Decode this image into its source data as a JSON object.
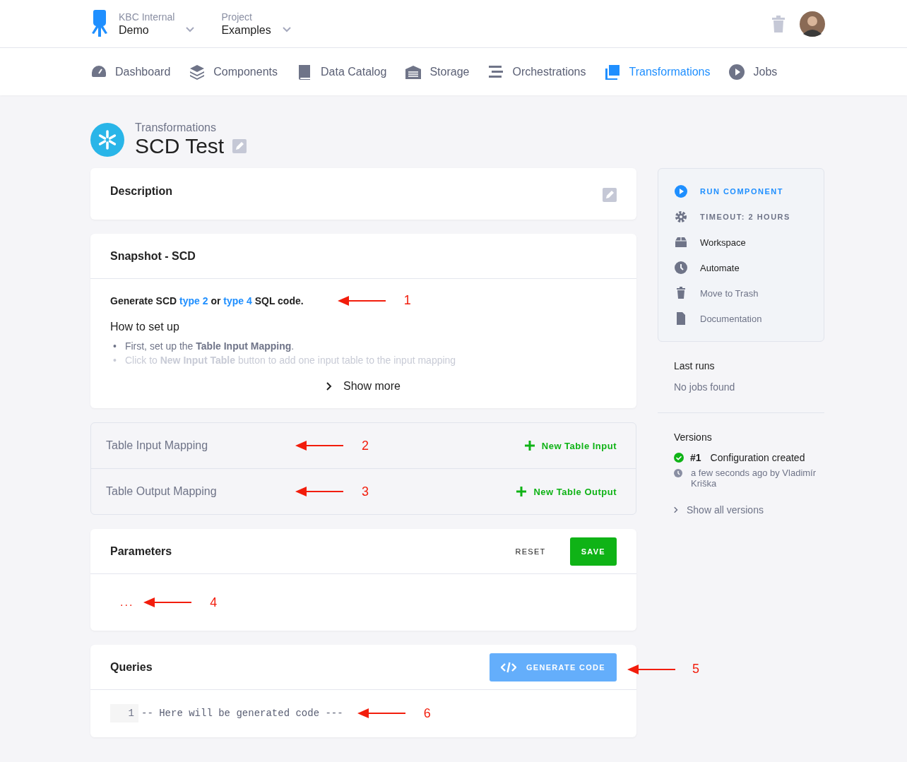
{
  "header": {
    "org_label": "KBC Internal",
    "org_name": "Demo",
    "project_label": "Project",
    "project_name": "Examples"
  },
  "nav": [
    {
      "label": "Dashboard",
      "selected": false
    },
    {
      "label": "Components",
      "selected": false
    },
    {
      "label": "Data Catalog",
      "selected": false
    },
    {
      "label": "Storage",
      "selected": false
    },
    {
      "label": "Orchestrations",
      "selected": false
    },
    {
      "label": "Transformations",
      "selected": true
    },
    {
      "label": "Jobs",
      "selected": false
    }
  ],
  "page": {
    "breadcrumb": "Transformations",
    "title": "SCD Test"
  },
  "description": {
    "title": "Description"
  },
  "snapshot": {
    "title": "Snapshot - SCD",
    "intro_parts": [
      {
        "text": "Generate SCD ",
        "kind": "text"
      },
      {
        "text": "type 2",
        "kind": "link"
      },
      {
        "text": " or ",
        "kind": "text"
      },
      {
        "text": "type 4",
        "kind": "link"
      },
      {
        "text": " SQL code.",
        "kind": "text"
      }
    ],
    "heading": "How to set up",
    "bullets": [
      {
        "marker": "•",
        "text": "First, set up the **Table Input Mapping**.",
        "faded": false
      },
      {
        "marker": "•",
        "text": "Click to **New Input Table** button to add one input table to the input mapping",
        "faded": true
      }
    ],
    "show_more": "Show more"
  },
  "mappings": [
    {
      "title": "Table Input Mapping",
      "action": "New Table Input"
    },
    {
      "title": "Table Output Mapping",
      "action": "New Table Output"
    }
  ],
  "parameters": {
    "title": "Parameters",
    "reset": "RESET",
    "save": "SAVE",
    "content": "..."
  },
  "queries": {
    "title": "Queries",
    "button": "GENERATE CODE",
    "lines": [
      {
        "number": "1",
        "code": "-- Here will be generated code ---"
      }
    ]
  },
  "annotations": [
    "1",
    "2",
    "3",
    "4",
    "5",
    "6"
  ],
  "actions": [
    {
      "label": "RUN COMPONENT",
      "kind": "primary"
    },
    {
      "label": "TIMEOUT: 2 HOURS",
      "kind": "caps"
    },
    {
      "label": "Workspace",
      "kind": "dark"
    },
    {
      "label": "Automate",
      "kind": "dark"
    },
    {
      "label": "Move to Trash",
      "kind": "muted"
    },
    {
      "label": "Documentation",
      "kind": "muted"
    }
  ],
  "last_runs": {
    "title": "Last runs",
    "empty": "No jobs found"
  },
  "versions": {
    "title": "Versions",
    "items": [
      {
        "number": "#1",
        "text": "Configuration created",
        "meta": "a few seconds ago by Vladimír Kriška"
      }
    ],
    "show_all": "Show all versions"
  }
}
